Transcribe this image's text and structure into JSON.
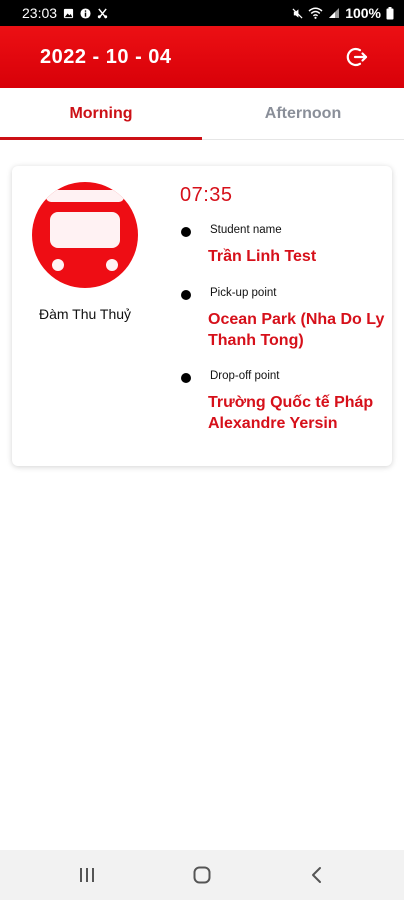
{
  "status_bar": {
    "time": "23:03",
    "battery": "100%",
    "icons_left": [
      "image-icon",
      "info-icon",
      "scissors-icon"
    ],
    "icons_right": [
      "mute-icon",
      "wifi-icon",
      "signal-icon",
      "battery-icon"
    ]
  },
  "header": {
    "date": "2022 - 10 - 04",
    "action_icon": "logout-icon"
  },
  "tabs": [
    {
      "label": "Morning",
      "active": true
    },
    {
      "label": "Afternoon",
      "active": false
    }
  ],
  "trip": {
    "driver_name": "Đàm Thu Thuỷ",
    "avatar_icon": "train-icon",
    "time": "07:35",
    "student_name_label": "Student name",
    "student_name": "Trần Linh Test",
    "pickup_label": "Pick-up point",
    "pickup_value": "Ocean Park (Nha Do Ly Thanh Tong)",
    "dropoff_label": "Drop-off point",
    "dropoff_value": "Trường Quốc tế Pháp Alexandre Yersin"
  },
  "nav_bar": {
    "buttons": [
      "recents-icon",
      "home-icon",
      "back-icon"
    ]
  },
  "colors": {
    "brand_red": "#d80008",
    "accent_red_text": "#d6101a",
    "inactive_tab": "#8a8f99"
  }
}
